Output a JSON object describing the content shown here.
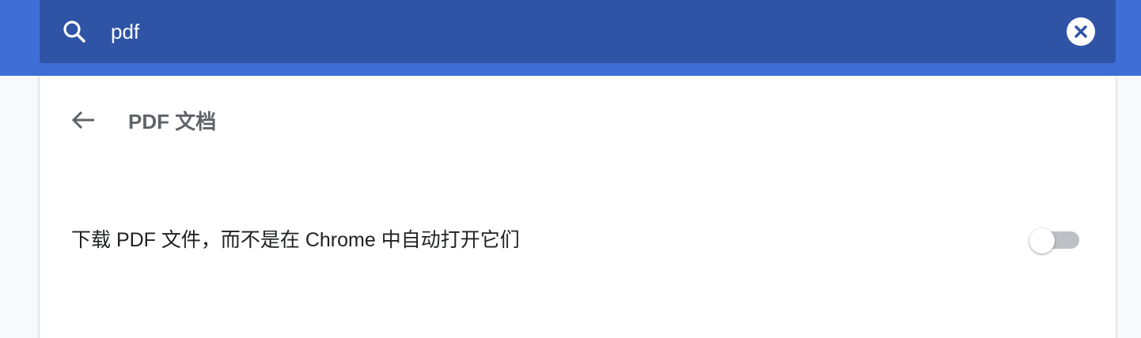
{
  "search": {
    "value": "pdf",
    "icon": "search-icon",
    "clear_icon": "close-icon"
  },
  "page": {
    "title": "PDF 文档",
    "back_icon": "arrow-back-icon"
  },
  "settings": [
    {
      "label": "下载 PDF 文件，而不是在 Chrome 中自动打开它们",
      "toggle_on": false
    }
  ],
  "colors": {
    "header_bg": "#3f6fd6",
    "searchbox_bg": "#2f54a6",
    "title_text": "#5f6368",
    "toggle_off_track": "#bdc1c6"
  }
}
